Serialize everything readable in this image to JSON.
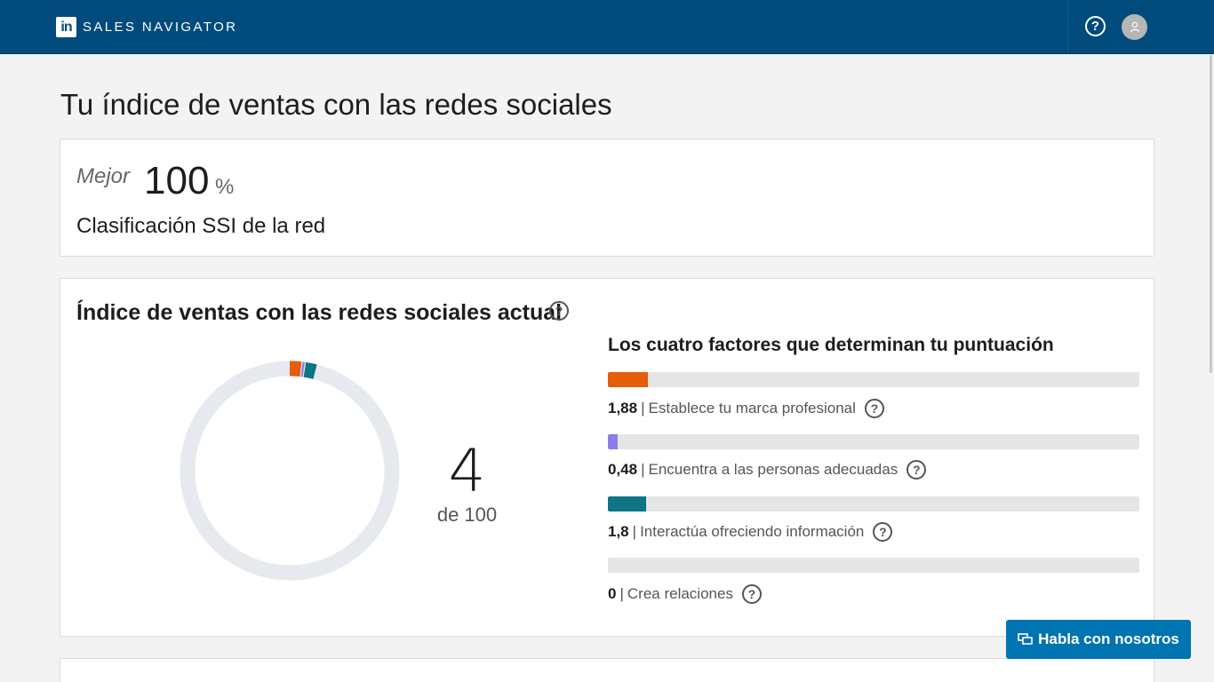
{
  "header": {
    "logo_text": "in",
    "brand": "SALES NAVIGATOR",
    "help_glyph": "?",
    "icons": [
      "linkedin-logo-icon",
      "help-icon",
      "avatar-icon"
    ]
  },
  "page": {
    "title": "Tu índice de ventas con las redes sociales"
  },
  "network_rank": {
    "best_label": "Mejor",
    "value": "100",
    "unit": "%",
    "label": "Clasificación SSI de la red"
  },
  "ssi": {
    "title": "Índice de ventas con las redes sociales actual",
    "score": "4",
    "score_sub": "de 100",
    "score_value": 4,
    "score_max": 100
  },
  "factors": {
    "title": "Los cuatro factores que determinan tu puntuación",
    "max": 25,
    "items": [
      {
        "value_text": "1,88",
        "value": 1.88,
        "separator": "|",
        "label": "Establece tu marca profesional",
        "color": "#e35d0b"
      },
      {
        "value_text": "0,48",
        "value": 0.48,
        "separator": "|",
        "label": "Encuentra a las personas adecuadas",
        "color": "#8c7ee8"
      },
      {
        "value_text": "1,8",
        "value": 1.8,
        "separator": "|",
        "label": "Interactúa ofreciendo información",
        "color": "#0e7585"
      },
      {
        "value_text": "0",
        "value": 0,
        "separator": "|",
        "label": "Crea relaciones",
        "color": "#c9a227"
      }
    ]
  },
  "chat": {
    "label": "Habla con nosotros",
    "icon": "chat-icon"
  },
  "colors": {
    "header_bg": "#004b7c",
    "accent": "#0073b1",
    "donut_track": "#e6eaee"
  }
}
